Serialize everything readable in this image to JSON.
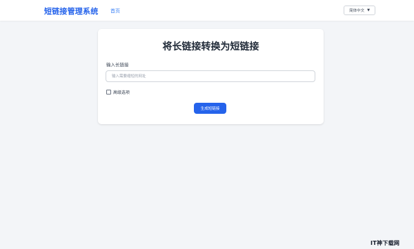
{
  "header": {
    "brand": "短链接管理系统",
    "nav_home": "首页",
    "language": {
      "selected": "简体中文",
      "caret": "▼"
    }
  },
  "form": {
    "title": "将长链接转换为短链接",
    "url_label": "输入长链接",
    "url_placeholder": "输入需要缩短的网址",
    "url_value": "",
    "advanced_label": "高级选项",
    "advanced_checked": false,
    "submit_label": "生成短链接"
  },
  "watermark": {
    "text": "IT神下载网"
  },
  "colors": {
    "accent": "#2563eb",
    "page_bg": "#f3f5f8",
    "card_bg": "#ffffff"
  }
}
